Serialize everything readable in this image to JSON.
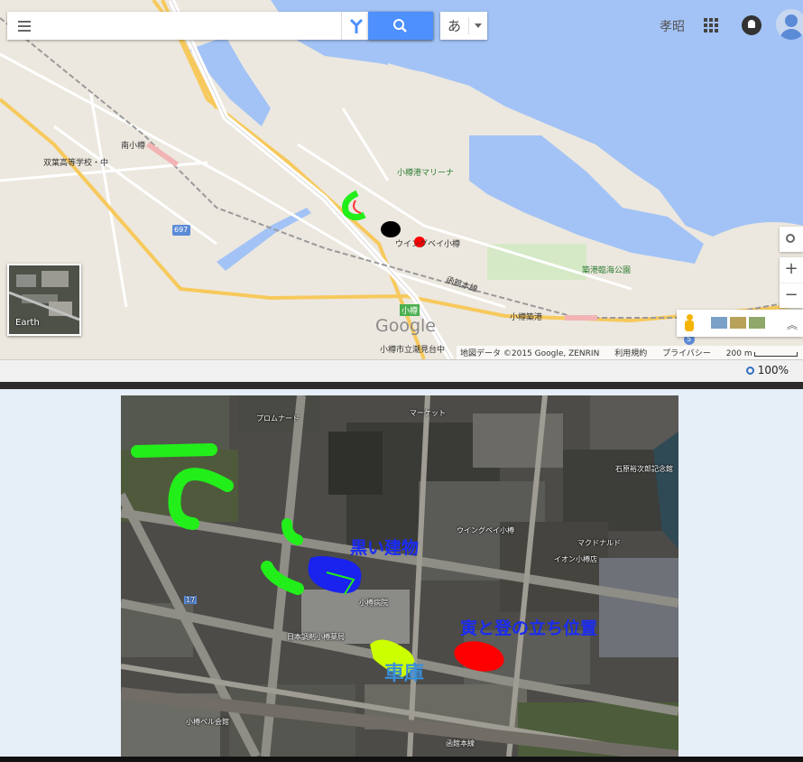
{
  "map": {
    "search_placeholder": "",
    "ime_label": "あ",
    "user_name": "孝昭",
    "earth_label": "Earth",
    "labels": {
      "minami_otaru": "南小樽",
      "futaba_school": "双葉高等学校・中",
      "otaru_marina": "小樽港マリーナ",
      "wing_bay": "ウイングベイ小樽",
      "chikko_park": "築港臨海公園",
      "hakodate_line": "函館本線",
      "otaru_chikko": "小樽築港",
      "otaru": "小樽",
      "school_bottom": "小樽市立潮見台中",
      "route_697": "697",
      "route_5": "5",
      "logo": "Google"
    },
    "attribution": {
      "map_data": "地図データ ©2015 Google, ZENRIN",
      "terms": "利用規約",
      "privacy": "プライバシー",
      "scale": "200 m"
    },
    "colors": {
      "land": "#ece8df",
      "water": "#a3c3f6",
      "road_major": "#f7c95c",
      "search_blue": "#4d90fe"
    }
  },
  "status": {
    "zoom": "100%"
  },
  "satellite": {
    "annotations": {
      "black_building": "黒い建物",
      "stand_position": "寅と登の立ち位置",
      "garage": "車庫"
    },
    "labels": {
      "promenade": "プロムナード",
      "warehouse": "マーケット",
      "sugiyama": "小樽病院",
      "aeon": "イオン小樽店",
      "mcdonalds": "マクドナルド",
      "ishihara": "石原裕次郎記念館",
      "kabuki": "小樽ベル会館",
      "nihon": "日本調剤小樽薬局",
      "route_17": "17",
      "hakodate": "函館本線",
      "wing_bay": "ウイングベイ小樽"
    },
    "colors": {
      "green_marks": "#22ee1a",
      "blue_mark": "#1a22ee",
      "red_mark": "#ff0000",
      "yellow_mark": "#ccff00"
    }
  }
}
